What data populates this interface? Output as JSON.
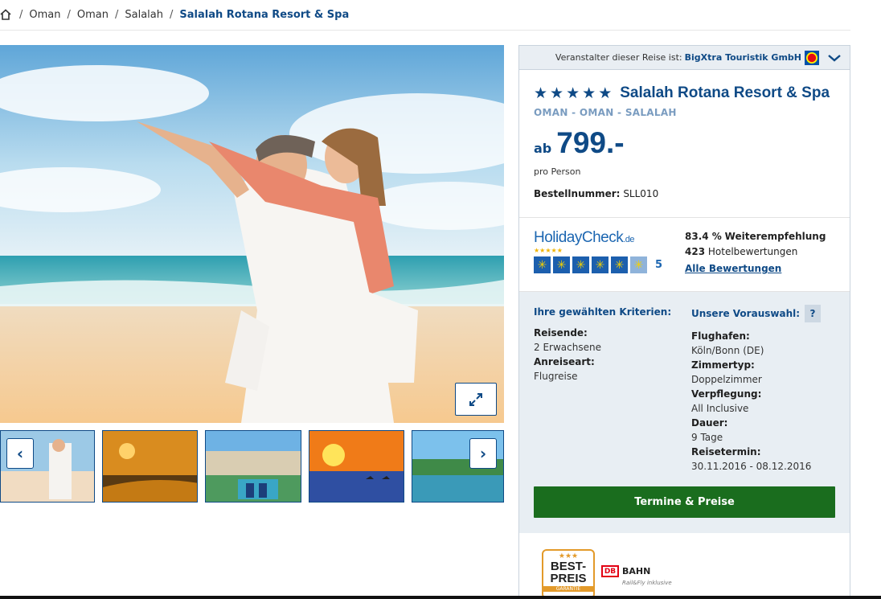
{
  "breadcrumb": {
    "items": [
      "Oman",
      "Oman",
      "Salalah"
    ],
    "current": "Salalah Rotana Resort & Spa"
  },
  "gallery": {
    "prev_label": "‹",
    "next_label": "›"
  },
  "operator": {
    "prefix": "Veranstalter dieser Reise ist:",
    "name": "BigXtra Touristik GmbH"
  },
  "hotel": {
    "stars": 5,
    "name": "Salalah Rotana Resort & Spa",
    "location": "OMAN - OMAN - SALALAH",
    "price_prefix": "ab",
    "price": "799.-",
    "per_person": "pro Person",
    "order_label": "Bestellnummer:",
    "order_number": "SLL010"
  },
  "rating": {
    "brand": "HolidayCheck",
    "brand_tld": ".de",
    "score": "5",
    "recommend_value": "83.4 %",
    "recommend_label": "Weiterempfehlung",
    "reviews_count": "423",
    "reviews_label": "Hotelbewertungen",
    "all_reviews_link": "Alle Bewertungen"
  },
  "criteria": {
    "left_title": "Ihre gewählten Kriterien:",
    "right_title": "Unsere Vorauswahl:",
    "help_label": "?",
    "travelers_label": "Reisende:",
    "travelers_value": "2 Erwachsene",
    "arrival_label": "Anreiseart:",
    "arrival_value": "Flugreise",
    "airport_label": "Flughafen:",
    "airport_value": "Köln/Bonn (DE)",
    "room_label": "Zimmertyp:",
    "room_value": "Doppelzimmer",
    "board_label": "Verpflegung:",
    "board_value": "All Inclusive",
    "duration_label": "Dauer:",
    "duration_value": "9 Tage",
    "date_label": "Reisetermin:",
    "date_value": "30.11.2016 - 08.12.2016",
    "cta_label": "Termine & Preise"
  },
  "badges": {
    "bestpreis_line1": "BEST-",
    "bestpreis_line2": "PREIS",
    "bestpreis_sub": "GARANTIE",
    "db_box": "DB",
    "db_name": "BAHN",
    "db_sub": "Rail&Fly inklusive"
  },
  "colors": {
    "brand_blue": "#0f4a86",
    "cta_green": "#1a6d1e",
    "panel_bg": "#e8eef3"
  }
}
